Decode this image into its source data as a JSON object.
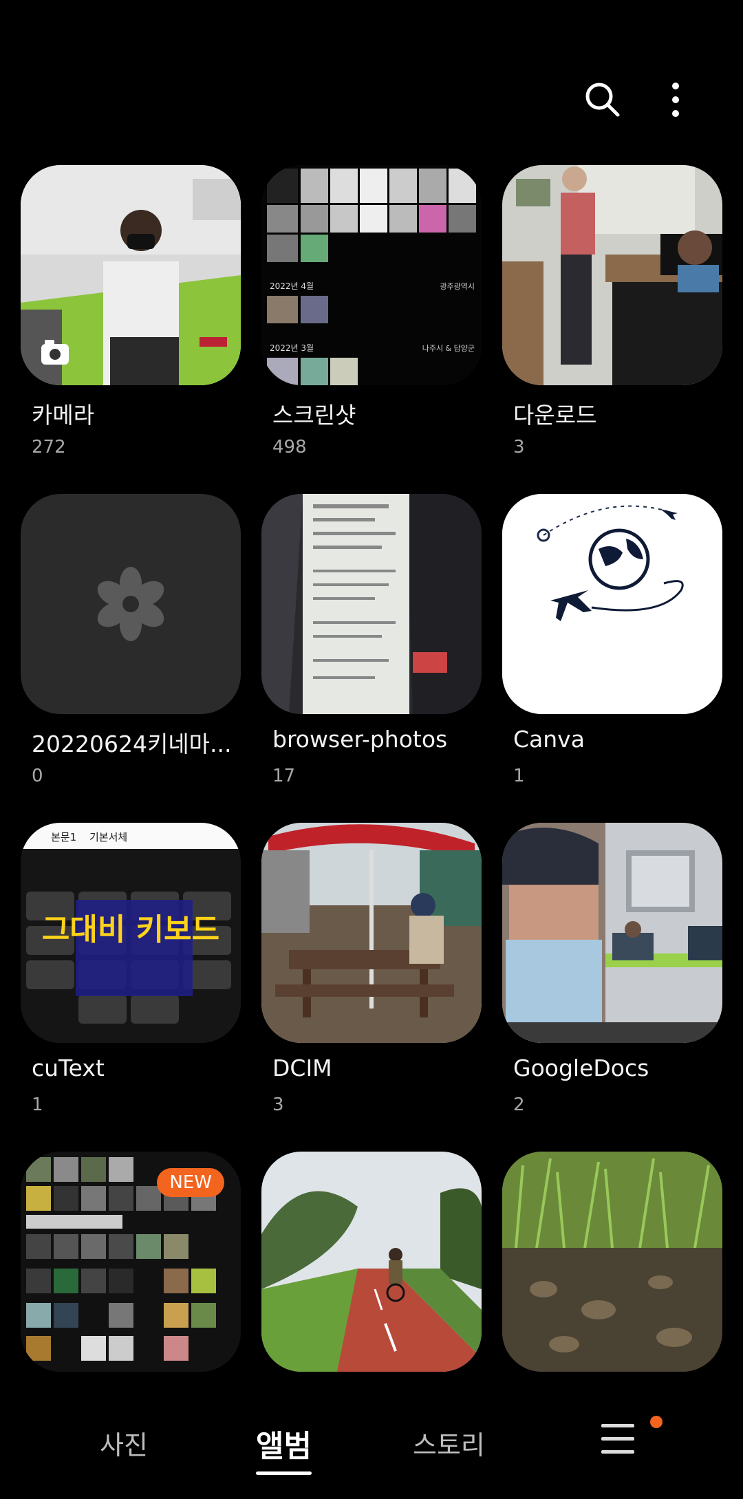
{
  "toolbar": {
    "search_icon": "search-icon",
    "more_icon": "more-vertical-icon"
  },
  "albums": [
    {
      "title": "카메라",
      "count": "272"
    },
    {
      "title": "스크린샷",
      "count": "498"
    },
    {
      "title": "다운로드",
      "count": "3"
    },
    {
      "title": "20220624키네마...",
      "count": "0"
    },
    {
      "title": "browser-photos",
      "count": "17"
    },
    {
      "title": "Canva",
      "count": "1"
    },
    {
      "title": "cuText",
      "count": "1"
    },
    {
      "title": "DCIM",
      "count": "3"
    },
    {
      "title": "GoogleDocs",
      "count": "2"
    },
    {
      "title": "",
      "count": ""
    },
    {
      "title": "",
      "count": ""
    },
    {
      "title": "",
      "count": ""
    }
  ],
  "thumb_text": {
    "screenshot_date1": "2022년 4월",
    "screenshot_place1": "광주광역시",
    "screenshot_date2": "2022년 3월",
    "screenshot_place2": "나주시 & 담양군",
    "keyboard_banner": "그대비 키보드",
    "keyboard_toolbar1": "본문1",
    "keyboard_toolbar2": "기본서체"
  },
  "badges": {
    "new": "NEW"
  },
  "nav": {
    "photos": "사진",
    "albums": "앨범",
    "stories": "스토리"
  },
  "colors": {
    "accent": "#f3641e",
    "background": "#000000"
  }
}
